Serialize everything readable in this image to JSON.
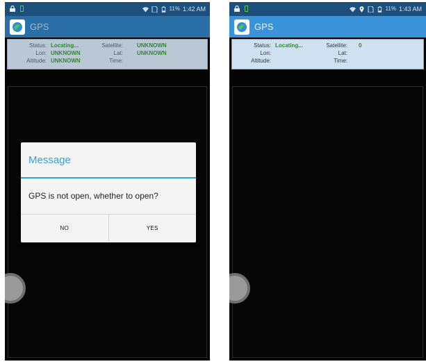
{
  "left_screen": {
    "status_bar": {
      "battery": "11%",
      "time": "1:42 AM"
    },
    "app_bar": {
      "title": "GPS"
    },
    "info_panel": {
      "status_label": "Status:",
      "status_value": "Locating...",
      "satellite_label": "Satellite:",
      "satellite_value": "UNKNOWN",
      "lon_label": "Lon:",
      "lon_value": "UNKNOWN",
      "lat_label": "Lat:",
      "lat_value": "UNKNOWN",
      "altitude_label": "Altitude:",
      "altitude_value": "UNKNOWN",
      "time_label": "Time:",
      "time_value": ""
    },
    "dialog": {
      "title": "Message",
      "message": "GPS is not open, whether to open?",
      "no_label": "NO",
      "yes_label": "YES"
    }
  },
  "right_screen": {
    "status_bar": {
      "battery": "11%",
      "time": "1:43 AM"
    },
    "app_bar": {
      "title": "GPS"
    },
    "info_panel": {
      "status_label": "Status:",
      "status_value": "Locating...",
      "satellite_label": "Satellite:",
      "satellite_value": "0",
      "lon_label": "Lon:",
      "lon_value": "",
      "lat_label": "Lat:",
      "lat_value": "",
      "altitude_label": "Altitude:",
      "altitude_value": "",
      "time_label": "Time:",
      "time_value": ""
    }
  },
  "colors": {
    "status_bar": "#1d4f7d",
    "app_bar": "#3a93d8",
    "dialog_accent": "#33a3d6",
    "value_green": "#2f8a2f"
  },
  "icons": [
    "lock-icon",
    "sim-icon",
    "wifi-icon",
    "location-icon",
    "no-sim-icon",
    "battery-icon",
    "app-logo-icon"
  ]
}
